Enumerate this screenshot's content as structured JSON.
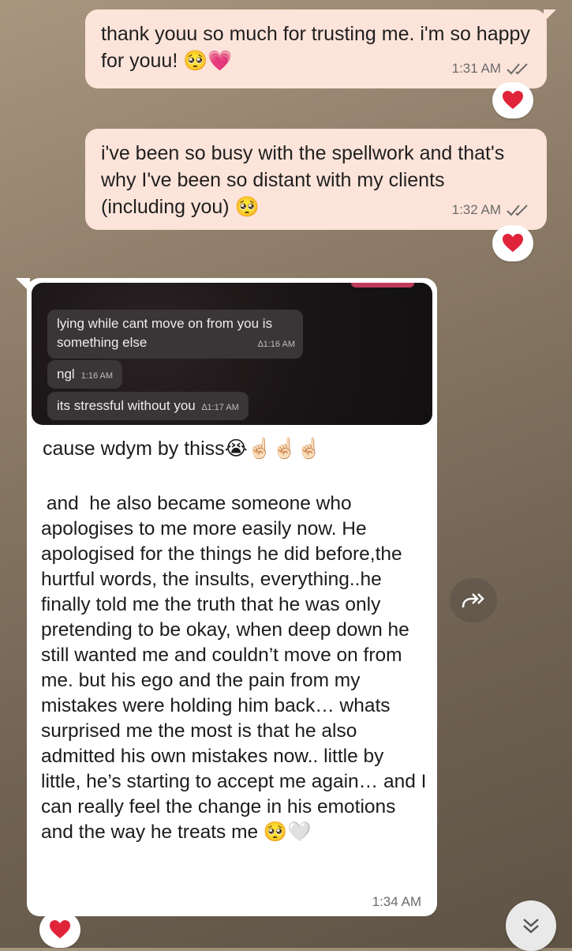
{
  "messages": [
    {
      "text": "thank youu so much for trusting me. i'm so happy for youu! 🥺💗",
      "time": "1:31 AM",
      "reaction": "❤️"
    },
    {
      "text": "i've been so busy with the spellwork and that's why I've been so distant with my clients (including you) 🥺",
      "time": "1:32 AM",
      "reaction": "❤️"
    }
  ],
  "incoming": {
    "quoted_screenshot": {
      "bubbles": [
        {
          "text": "lying while cant move on from you is something else",
          "time": "∆1:16 AM"
        },
        {
          "text": "ngl",
          "time": "1:16 AM"
        },
        {
          "text": "its stressful without you",
          "time": "∆1:17 AM"
        }
      ]
    },
    "caption": "cause wdym by thiss😭☝🏻☝🏻☝🏻",
    "body": " and  he also became someone who apologises to me more easily now. He apologised for the things he did before,the hurtful words, the insults, everything..he finally told me the truth that he was only pretending to be okay, when deep down he still wanted me and couldn’t move on from me. but his ego and the pain from my mistakes were holding him back… whats surprised me the most is that he also admitted his own mistakes now.. little by little, he’s starting to accept me again… and I can really feel the change in his emotions and the way he treats me 🥺🤍",
    "time": "1:34 AM",
    "reaction": "❤️"
  },
  "icons": {
    "read_ticks": "double-check-icon",
    "forward": "forward-icon",
    "scroll_down": "double-chevron-down-icon"
  },
  "colors": {
    "outgoing_bubble": "#fde4da",
    "incoming_bubble": "#ffffff",
    "heart": "#e0243a",
    "tick": "#6b6b6b"
  }
}
